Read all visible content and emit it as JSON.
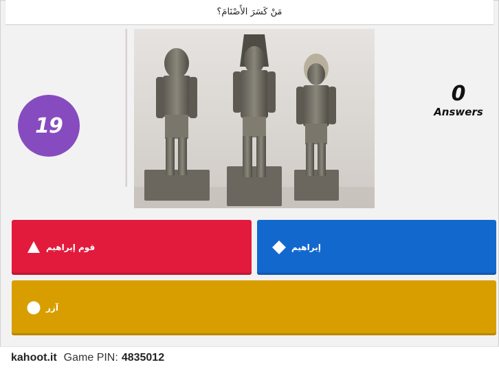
{
  "question": {
    "text": "مَنْ كَسَرَ الأَصْنَامَ؟"
  },
  "timer": {
    "value": "19",
    "color": "#864cbf"
  },
  "answers_counter": {
    "count": "0",
    "label": "Answers"
  },
  "image": {
    "subject": "three-egyptian-statues-photo"
  },
  "answers": [
    {
      "label": "قوم إبراهيم",
      "shape": "triangle-icon",
      "color": "#e21b3c"
    },
    {
      "label": "إبراهيم",
      "shape": "diamond-icon",
      "color": "#1368ce"
    },
    {
      "label": "آزر",
      "shape": "circle-icon",
      "color": "#d89e00"
    }
  ],
  "footer": {
    "site": "kahoot.it",
    "pin_label": "Game PIN:",
    "pin": "4835012"
  }
}
